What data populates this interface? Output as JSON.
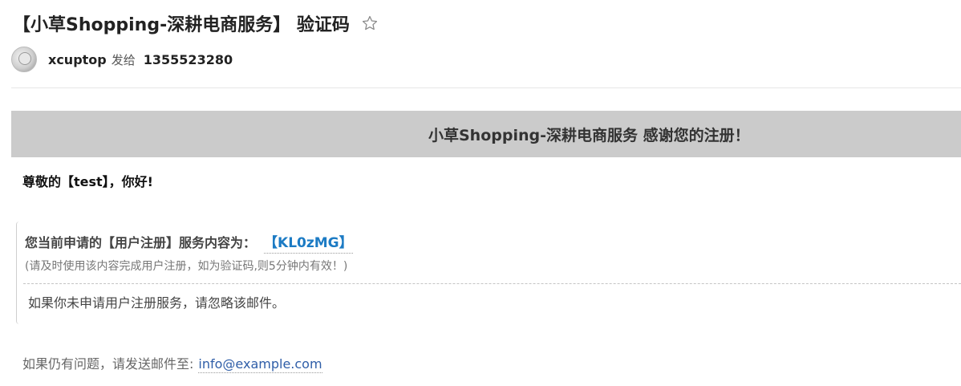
{
  "email": {
    "subject": "【小草Shopping-深耕电商服务】 验证码",
    "starred": false
  },
  "sender": {
    "name": "xcuptop",
    "sent_to_label": "发给",
    "recipient": "1355523280"
  },
  "body": {
    "banner_text": "小草Shopping-深耕电商服务 感谢您的注册！",
    "greeting": "尊敬的【test】，你好!",
    "service_label": "您当前申请的【用户注册】服务内容为：",
    "code": "【KL0zMG】",
    "note": "(请及时使用该内容完成用户注册，如为验证码,则5分钟内有效！)",
    "ignore_text": "如果你未申请用户注册服务，请忽略该邮件。",
    "footer_prefix": "如果仍有问题，请发送邮件至:",
    "footer_email": "info@example.com"
  },
  "icons": {
    "star": "star-outline-icon",
    "avatar": "avatar-image"
  },
  "colors": {
    "banner_bg": "#cbcbcb",
    "code_color": "#1c7bc4",
    "link_color": "#2f5ea8"
  }
}
